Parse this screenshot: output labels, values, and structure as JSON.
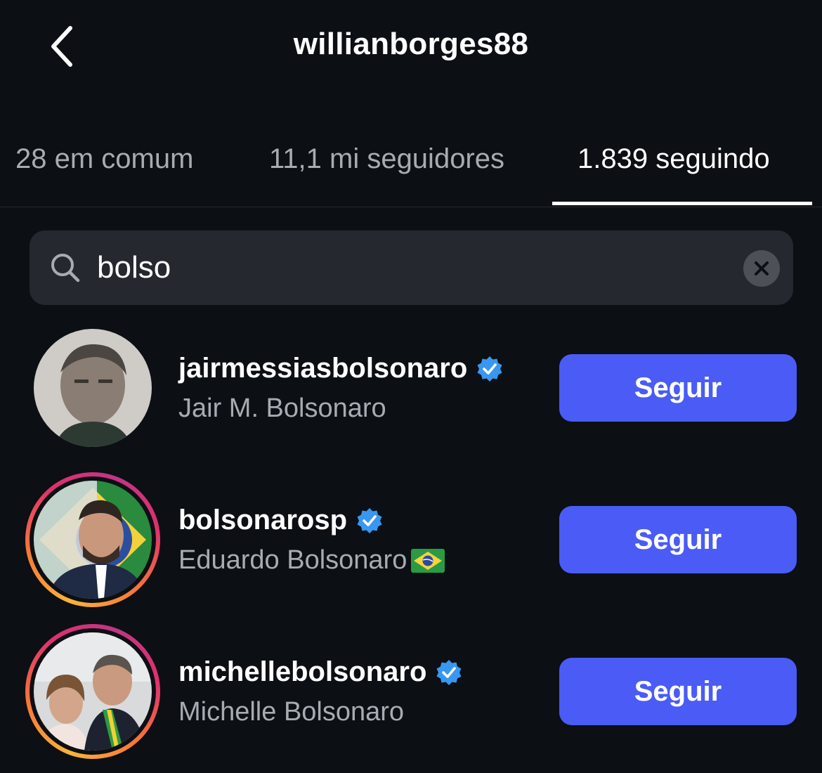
{
  "header": {
    "title": "willianborges88"
  },
  "tabs": [
    {
      "label": "28 em comum"
    },
    {
      "label": "11,1 mi seguidores"
    },
    {
      "label": "1.839 seguindo"
    }
  ],
  "search": {
    "value": "bolso"
  },
  "results": [
    {
      "username": "jairmessiasbolsonaro",
      "full_name": "Jair M. Bolsonaro",
      "verified": true,
      "has_story_ring": false,
      "button_label": "Seguir"
    },
    {
      "username": "bolsonarosp",
      "full_name": "Eduardo Bolsonaro",
      "flag_emoji": "brazil-flag-icon",
      "verified": true,
      "has_story_ring": true,
      "button_label": "Seguir"
    },
    {
      "username": "michellebolsonaro",
      "full_name": "Michelle Bolsonaro",
      "verified": true,
      "has_story_ring": true,
      "button_label": "Seguir"
    }
  ],
  "colors": {
    "background": "#0c0f14",
    "search_bg": "#25282e",
    "button_blue": "#4a5cf5",
    "verified_blue": "#3897f0",
    "muted_text": "#a8acb2"
  }
}
